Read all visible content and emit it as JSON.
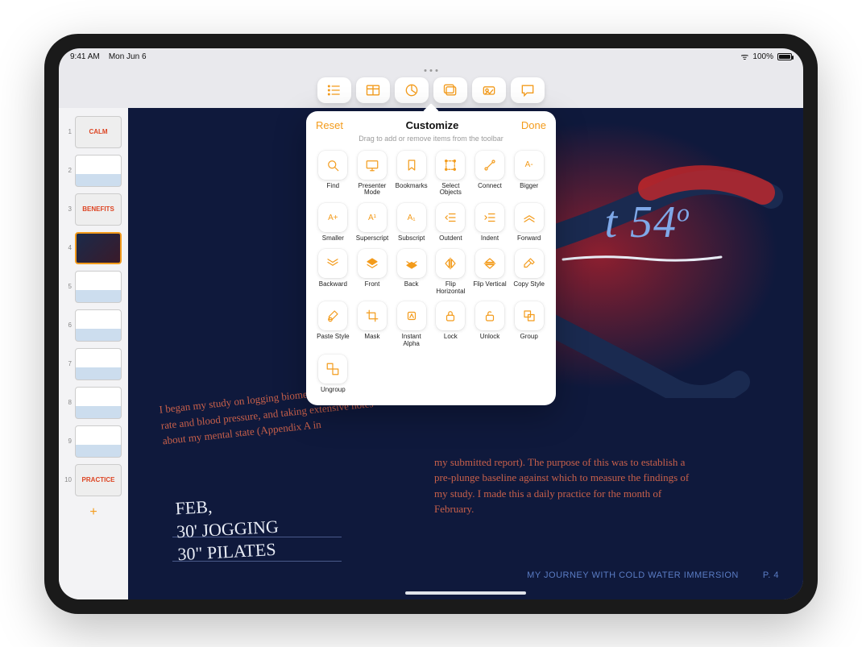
{
  "statusbar": {
    "time": "9:41 AM",
    "date": "Mon Jun 6",
    "battery_pct": "100%"
  },
  "toolbar": {
    "buttons": [
      "format-list",
      "table",
      "chart",
      "media",
      "shape",
      "comment"
    ]
  },
  "popover": {
    "reset": "Reset",
    "title": "Customize",
    "done": "Done",
    "hint": "Drag to add or remove items from the toolbar",
    "items": [
      {
        "id": "find",
        "label": "Find",
        "icon": "search"
      },
      {
        "id": "presenter",
        "label": "Presenter Mode",
        "icon": "screen"
      },
      {
        "id": "bookmarks",
        "label": "Bookmarks",
        "icon": "bookmark"
      },
      {
        "id": "select-objects",
        "label": "Select Objects",
        "icon": "select"
      },
      {
        "id": "connect",
        "label": "Connect",
        "icon": "connect"
      },
      {
        "id": "bigger",
        "label": "Bigger",
        "icon": "A-",
        "text": "A-"
      },
      {
        "id": "smaller",
        "label": "Smaller",
        "icon": "A+",
        "text": "A+"
      },
      {
        "id": "superscript",
        "label": "Superscript",
        "icon": "sup",
        "text": "A¹"
      },
      {
        "id": "subscript",
        "label": "Subscript",
        "icon": "sub",
        "text": "A₁"
      },
      {
        "id": "outdent",
        "label": "Outdent",
        "icon": "outdent"
      },
      {
        "id": "indent",
        "label": "Indent",
        "icon": "indent"
      },
      {
        "id": "forward",
        "label": "Forward",
        "icon": "forward"
      },
      {
        "id": "backward",
        "label": "Backward",
        "icon": "backward"
      },
      {
        "id": "front",
        "label": "Front",
        "icon": "front"
      },
      {
        "id": "back",
        "label": "Back",
        "icon": "back"
      },
      {
        "id": "flip-horizontal",
        "label": "Flip Horizontal",
        "icon": "fliph"
      },
      {
        "id": "flip-vertical",
        "label": "Flip Vertical",
        "icon": "flipv"
      },
      {
        "id": "copy-style",
        "label": "Copy Style",
        "icon": "eyedrop"
      },
      {
        "id": "paste-style",
        "label": "Paste Style",
        "icon": "paintbrush"
      },
      {
        "id": "mask",
        "label": "Mask",
        "icon": "crop"
      },
      {
        "id": "instant-alpha",
        "label": "Instant Alpha",
        "icon": "alpha"
      },
      {
        "id": "lock",
        "label": "Lock",
        "icon": "lock"
      },
      {
        "id": "unlock",
        "label": "Unlock",
        "icon": "unlock"
      },
      {
        "id": "group",
        "label": "Group",
        "icon": "group"
      },
      {
        "id": "ungroup",
        "label": "Ungroup",
        "icon": "ungroup"
      }
    ]
  },
  "sidebar": {
    "pages": [
      {
        "n": "1",
        "kind": "light",
        "title": "CALM"
      },
      {
        "n": "2",
        "kind": "light",
        "title": ""
      },
      {
        "n": "3",
        "kind": "light",
        "title": "BENEFITS"
      },
      {
        "n": "4",
        "kind": "dark-sel",
        "title": ""
      },
      {
        "n": "5",
        "kind": "light",
        "title": ""
      },
      {
        "n": "6",
        "kind": "light",
        "title": ""
      },
      {
        "n": "7",
        "kind": "light",
        "title": ""
      },
      {
        "n": "8",
        "kind": "light",
        "title": ""
      },
      {
        "n": "9",
        "kind": "light",
        "title": ""
      },
      {
        "n": "10",
        "kind": "light",
        "title": "PRACTICE"
      }
    ]
  },
  "canvas": {
    "big_number": "t 54",
    "big_degree": "o",
    "paragraph_left": "I began my study on logging biometric data, heart rate and blood pressure, and taking extensive notes about my mental state (Appendix A in",
    "paragraph_right": "my submitted report). The purpose of this was to establish a pre-plunge baseline against which to measure the findings of my study. I made this a daily practice for the month of February.",
    "handwriting_l1": "FEB,",
    "handwriting_l2": "30' JOGGING",
    "handwriting_l3": "30\" PILATES",
    "footer_title": "MY JOURNEY WITH COLD WATER IMMERSION",
    "footer_page": "P. 4"
  }
}
